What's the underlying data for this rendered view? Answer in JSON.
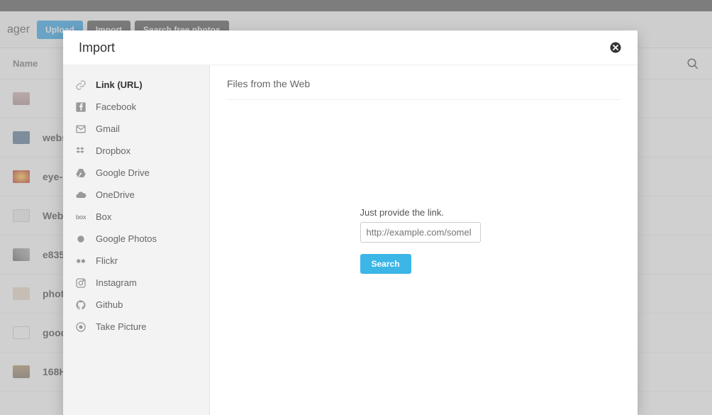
{
  "colors": {
    "primary_button": "#1c9be8",
    "dark_button": "#444444",
    "search_button": "#3cb5e7"
  },
  "background": {
    "page_title_fragment": "ager",
    "upload_label": "Upload",
    "import_label": "Import",
    "search_photos_label": "Search free photos",
    "column_header": "Name",
    "rows": [
      {
        "name": ""
      },
      {
        "name": "webs"
      },
      {
        "name": "eye-s"
      },
      {
        "name": "Webs"
      },
      {
        "name": "e835"
      },
      {
        "name": "phot"
      },
      {
        "name": "good"
      },
      {
        "name": "168H"
      }
    ]
  },
  "modal": {
    "title": "Import",
    "sidebar": {
      "items": [
        {
          "label": "Link (URL)",
          "icon": "link",
          "active": true
        },
        {
          "label": "Facebook",
          "icon": "facebook"
        },
        {
          "label": "Gmail",
          "icon": "gmail"
        },
        {
          "label": "Dropbox",
          "icon": "dropbox"
        },
        {
          "label": "Google Drive",
          "icon": "gdrive"
        },
        {
          "label": "OneDrive",
          "icon": "onedrive"
        },
        {
          "label": "Box",
          "icon": "box"
        },
        {
          "label": "Google Photos",
          "icon": "gphotos"
        },
        {
          "label": "Flickr",
          "icon": "flickr"
        },
        {
          "label": "Instagram",
          "icon": "instagram"
        },
        {
          "label": "Github",
          "icon": "github"
        },
        {
          "label": "Take Picture",
          "icon": "camera"
        }
      ]
    },
    "content": {
      "section_title": "Files from the Web",
      "prompt_text": "Just provide the link.",
      "input_placeholder": "http://example.com/somel",
      "search_button_label": "Search"
    }
  }
}
